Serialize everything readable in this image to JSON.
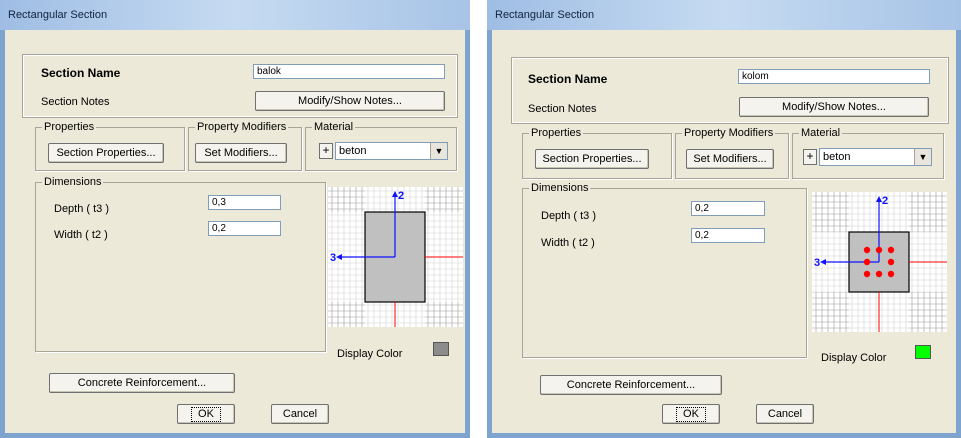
{
  "dialogs": [
    {
      "title": "Rectangular Section",
      "section_name_label": "Section Name",
      "section_name_value": "balok",
      "section_notes_label": "Section Notes",
      "modify_notes_button": "Modify/Show Notes...",
      "properties_group": "Properties",
      "section_properties_button": "Section Properties...",
      "property_modifiers_group": "Property Modifiers",
      "set_modifiers_button": "Set Modifiers...",
      "material_group": "Material",
      "material_add_button": "+",
      "material_value": "beton",
      "dimensions_group": "Dimensions",
      "depth_label": "Depth  ( t3 )",
      "depth_value": "0,3",
      "width_label": "Width  ( t2 )",
      "width_value": "0,2",
      "display_color_label": "Display Color",
      "display_color": "#8c8c8c",
      "concrete_reinforcement_button": "Concrete Reinforcement...",
      "ok_button": "OK",
      "cancel_button": "Cancel",
      "diagram": {
        "axis2_label": "2",
        "axis3_label": "3",
        "rebar_dots": 0
      }
    },
    {
      "title": "Rectangular Section",
      "section_name_label": "Section Name",
      "section_name_value": "kolom",
      "section_notes_label": "Section Notes",
      "modify_notes_button": "Modify/Show Notes...",
      "properties_group": "Properties",
      "section_properties_button": "Section Properties...",
      "property_modifiers_group": "Property Modifiers",
      "set_modifiers_button": "Set Modifiers...",
      "material_group": "Material",
      "material_add_button": "+",
      "material_value": "beton",
      "dimensions_group": "Dimensions",
      "depth_label": "Depth  ( t3 )",
      "depth_value": "0,2",
      "width_label": "Width  ( t2 )",
      "width_value": "0,2",
      "display_color_label": "Display Color",
      "display_color": "#00ff00",
      "concrete_reinforcement_button": "Concrete Reinforcement...",
      "ok_button": "OK",
      "cancel_button": "Cancel",
      "diagram": {
        "axis2_label": "2",
        "axis3_label": "3",
        "rebar_dots": 8
      }
    }
  ],
  "colors": {
    "window_frame": "#7fa3cf",
    "dialog_bg": "#ece9d8",
    "section_fill": "#c0c0c0",
    "axis_blue": "#1010ff",
    "axis_red": "#ff0000",
    "rebar": "#ff0000"
  }
}
